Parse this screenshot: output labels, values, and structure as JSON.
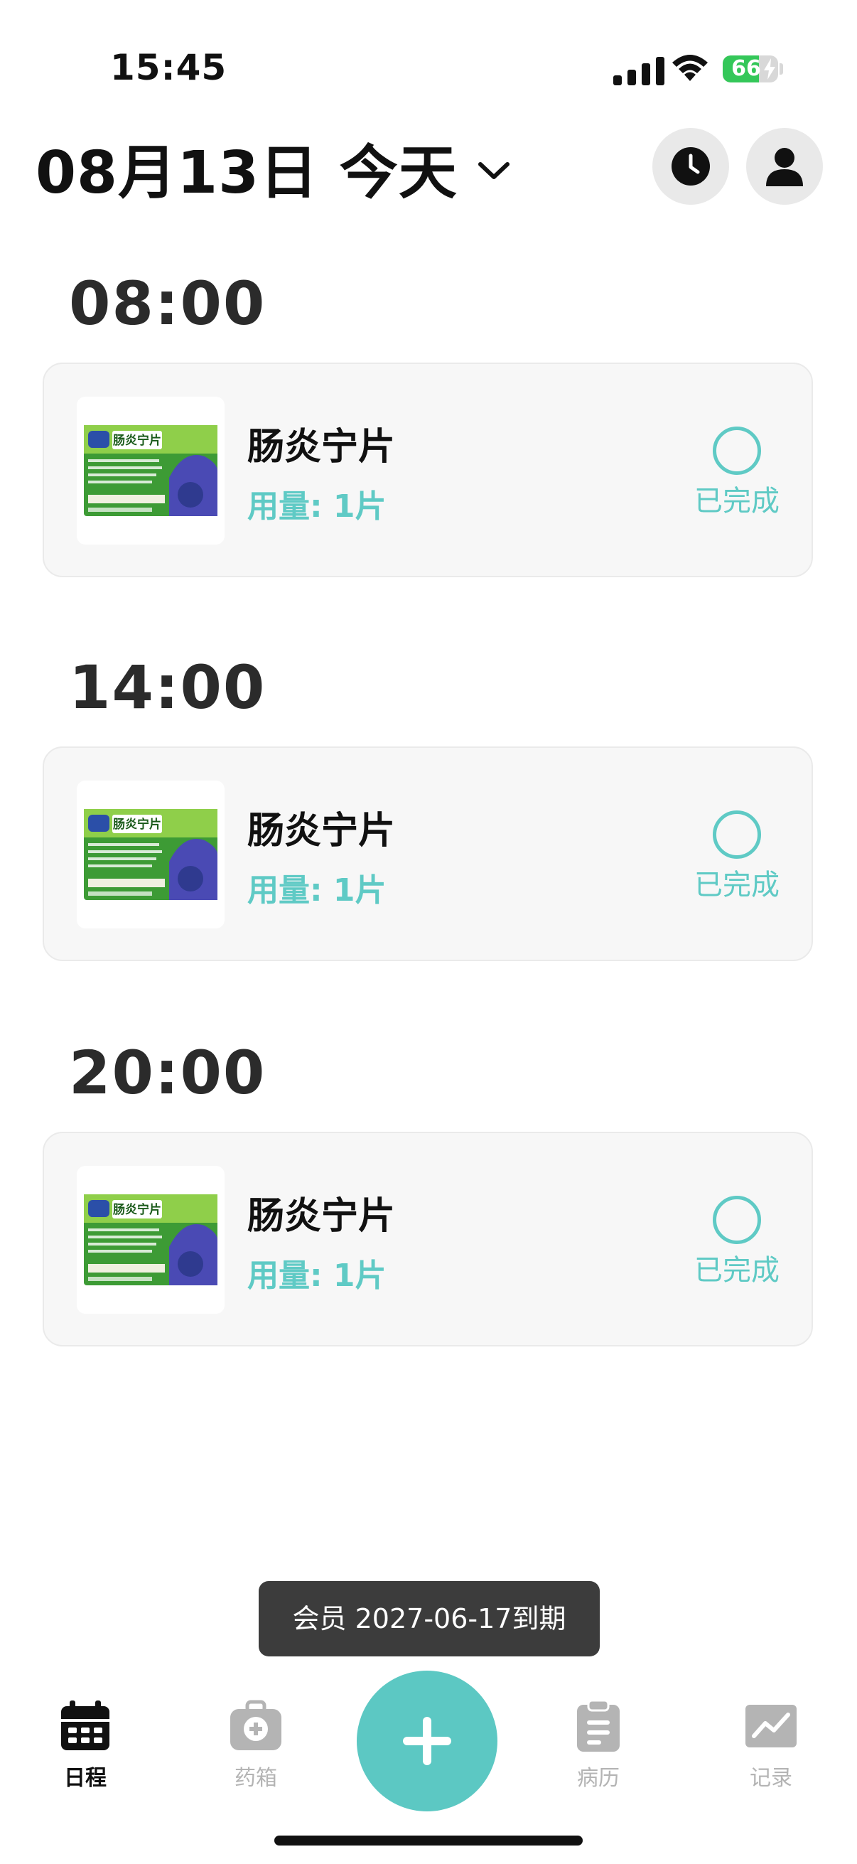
{
  "status_bar": {
    "time": "15:45",
    "battery_level": "66",
    "battery_fraction": 0.66,
    "battery_color": "#34c759"
  },
  "header": {
    "date_title": "08月13日 今天",
    "history_icon": "clock-icon",
    "profile_icon": "user-icon"
  },
  "schedule": [
    {
      "time": "08:00",
      "medicine": {
        "name": "肠炎宁片",
        "dose": "用量: 1片",
        "done_label": "已完成",
        "image_text": "肠炎宁片"
      }
    },
    {
      "time": "14:00",
      "medicine": {
        "name": "肠炎宁片",
        "dose": "用量: 1片",
        "done_label": "已完成",
        "image_text": "肠炎宁片"
      }
    },
    {
      "time": "20:00",
      "medicine": {
        "name": "肠炎宁片",
        "dose": "用量: 1片",
        "done_label": "已完成",
        "image_text": "肠炎宁片"
      }
    }
  ],
  "toast": {
    "text": "会员 2027-06-17到期"
  },
  "tab_bar": {
    "tabs": [
      {
        "label": "日程",
        "icon": "calendar-icon",
        "active": true
      },
      {
        "label": "药箱",
        "icon": "medkit-icon",
        "active": false
      },
      {
        "label": "病历",
        "icon": "clipboard-icon",
        "active": false
      },
      {
        "label": "记录",
        "icon": "chart-icon",
        "active": false
      }
    ],
    "add_icon": "plus-icon"
  },
  "colors": {
    "accent": "#5fcac5",
    "card_background": "#f7f7f7",
    "toast_background": "#3c3c3c",
    "inactive_tab": "#b4b4b4"
  }
}
